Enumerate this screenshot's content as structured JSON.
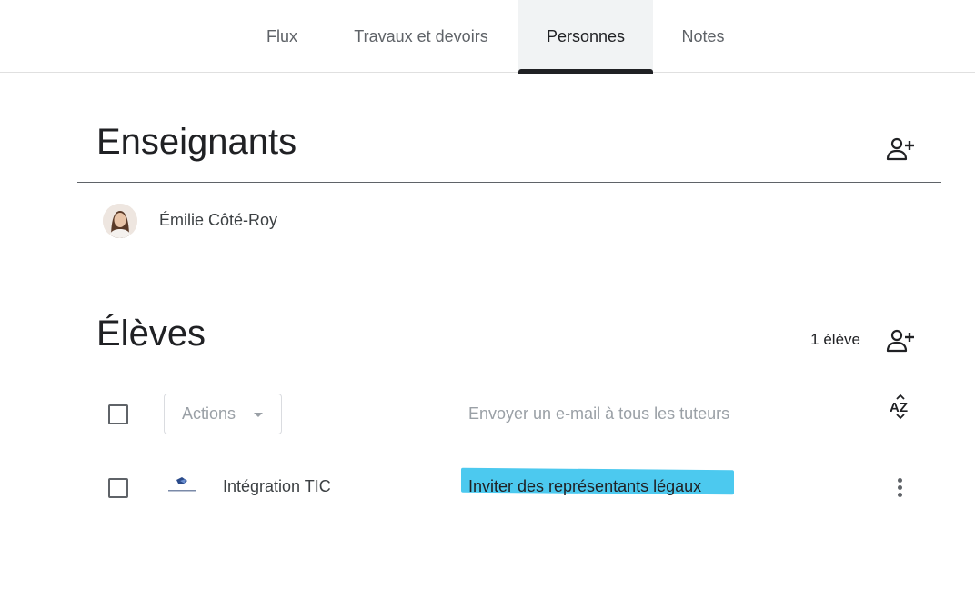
{
  "tabs": [
    {
      "label": "Flux"
    },
    {
      "label": "Travaux et devoirs"
    },
    {
      "label": "Personnes"
    },
    {
      "label": "Notes"
    }
  ],
  "active_tab": "Personnes",
  "teachers": {
    "title": "Enseignants",
    "add_icon": "person-add-icon",
    "list": [
      {
        "name": "Émilie Côté-Roy",
        "avatar": "photo"
      }
    ]
  },
  "students": {
    "title": "Élèves",
    "count_label": "1 élève",
    "add_icon": "person-add-icon",
    "toolbar": {
      "actions_label": "Actions",
      "email_all_label": "Envoyer un e-mail à tous les tuteurs",
      "sort_icon": "sort-az-icon"
    },
    "list": [
      {
        "name": "Intégration TIC",
        "invite_label": "Inviter des représentants légaux",
        "more_icon": "more-vert-icon"
      }
    ]
  },
  "colors": {
    "highlight": "#4cc9ef",
    "active_tab_bg": "#f1f3f4",
    "active_tab_indicator": "#202124",
    "muted_text": "#9aa0a6"
  }
}
